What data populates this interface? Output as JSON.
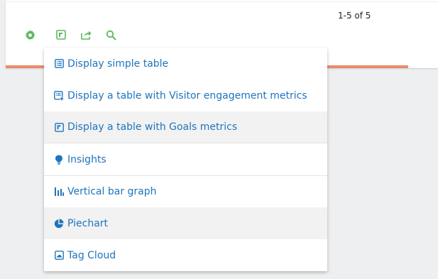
{
  "pagination": {
    "text": "1-5 of 5"
  },
  "toolbar": {
    "icons": [
      "gear-icon",
      "table-icon",
      "export-icon",
      "search-icon"
    ],
    "color": "#5cb85c"
  },
  "progress": {
    "color": "#ec8a6c"
  },
  "menu": {
    "accent": "#1f74bd",
    "items": [
      {
        "label": "Display simple table",
        "icon": "table-list-icon"
      },
      {
        "label": "Display a table with Visitor engagement metrics",
        "icon": "table-plus-icon"
      },
      {
        "label": "Display a table with Goals metrics",
        "icon": "goals-table-icon"
      },
      {
        "label": "Insights",
        "icon": "lightbulb-icon"
      },
      {
        "label": "Vertical bar graph",
        "icon": "bar-chart-icon"
      },
      {
        "label": "Piechart",
        "icon": "pie-chart-icon"
      },
      {
        "label": "Tag Cloud",
        "icon": "tag-cloud-icon"
      }
    ]
  }
}
